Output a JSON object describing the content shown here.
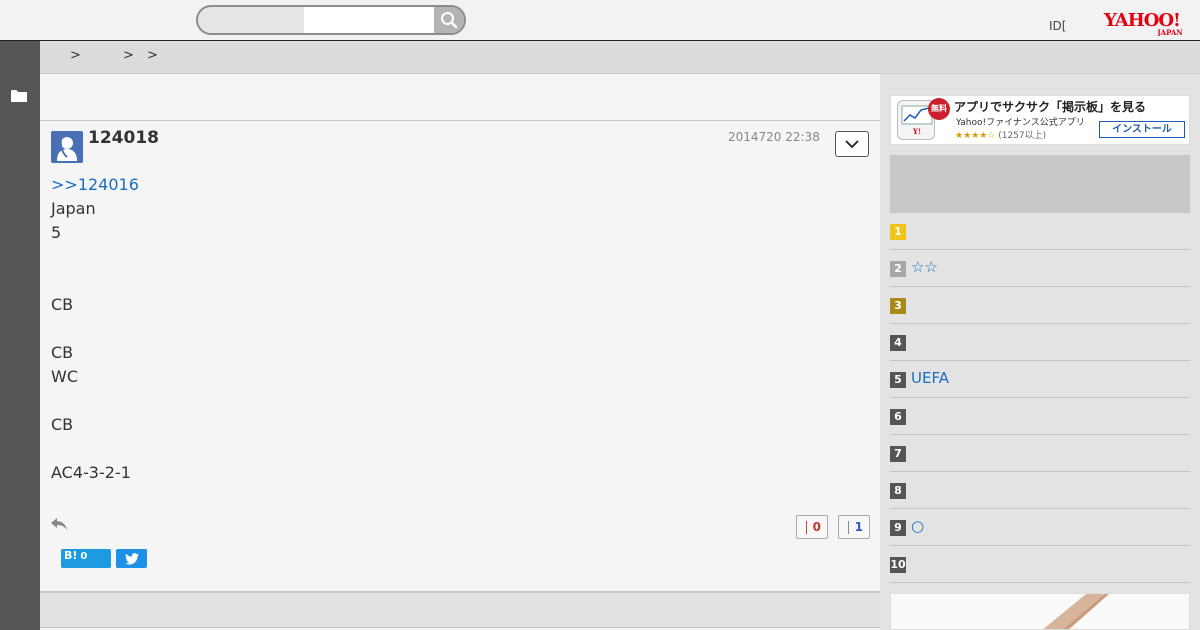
{
  "header": {
    "search_placeholder": "",
    "id_label": "ID[",
    "logo_text": "YAHOO!",
    "logo_sub": "JAPAN"
  },
  "breadcrumb": {
    "separators": [
      ">",
      ">",
      ">"
    ]
  },
  "post": {
    "number": "124018",
    "date": "2014720 22:38",
    "reply_to": ">>124016",
    "lines": [
      "Japan",
      "5",
      "",
      "",
      "CB",
      "",
      "CB",
      "WC",
      "",
      "CB",
      "",
      "AC4-3-2-1"
    ],
    "votes": {
      "good": "0",
      "bad": "1"
    },
    "share": {
      "hatena_label": "B!",
      "hatena_count": "0"
    }
  },
  "sidebar": {
    "ad": {
      "free_badge": "無料",
      "title": "アプリでサクサク「掲示板」を見る",
      "subtitle": "Yahoo!ファイナンス公式アプリ",
      "stars": "★★★★☆",
      "review_count": "(1257以上)",
      "install_label": "インストール"
    },
    "ranking": [
      {
        "num": "1",
        "text": "",
        "color": "#f0c419"
      },
      {
        "num": "2",
        "text": "☆☆",
        "color": "#a8a8a8"
      },
      {
        "num": "3",
        "text": "",
        "color": "#a88a1a"
      },
      {
        "num": "4",
        "text": "",
        "color": "#555555"
      },
      {
        "num": "5",
        "text": "UEFA",
        "color": "#555555"
      },
      {
        "num": "6",
        "text": "",
        "color": "#555555"
      },
      {
        "num": "7",
        "text": "",
        "color": "#555555"
      },
      {
        "num": "8",
        "text": "",
        "color": "#555555"
      },
      {
        "num": "9",
        "text": "○",
        "color": "#555555"
      },
      {
        "num": "10",
        "text": "",
        "color": "#555555"
      }
    ]
  },
  "colors": {
    "link": "#1a6ec2",
    "rail": "#555555",
    "accent_red": "#cc1f2d"
  }
}
